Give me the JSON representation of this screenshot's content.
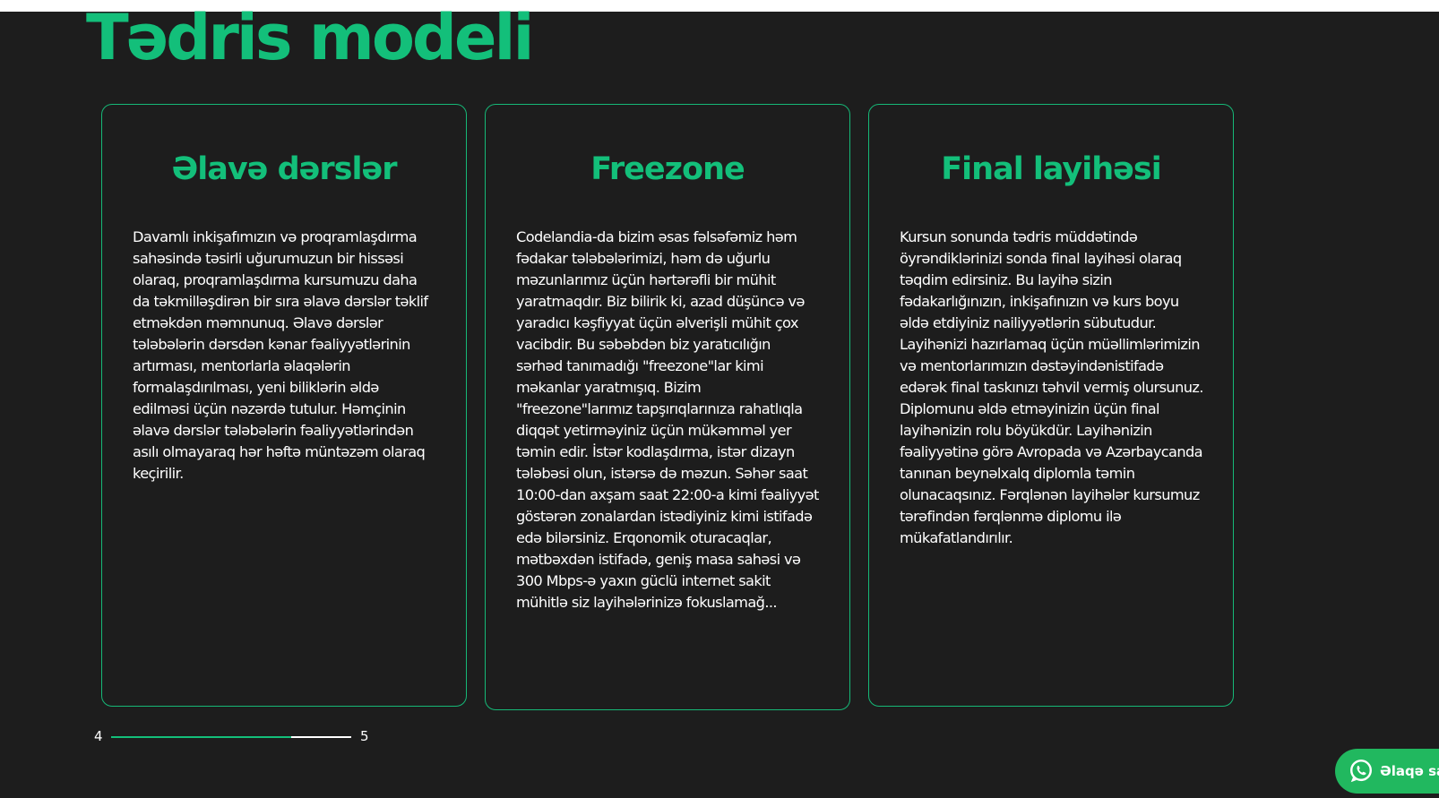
{
  "section": {
    "title": "Tədris modeli"
  },
  "cards": [
    {
      "title": "Əlavə dərslər",
      "text": "Davamlı inkişafımızın və proqramlaşdırma sahəsində təsirli uğurumuzun bir hissəsi olaraq, proqramlaşdırma kursumuzu daha da təkmilləşdirən bir sıra əlavə dərslər təklif etməkdən məmnunuq. Əlavə dərslər tələbələrin dərsdən kənar fəaliyyətlərinin artırması, mentorlarla əlaqələrin formalaşdırılması, yeni biliklərin əldə edilməsi üçün nəzərdə tutulur. Həmçinin əlavə dərslər tələbələrin fəaliyyətlərindən asılı olmayaraq hər həftə müntəzəm olaraq keçirilir."
    },
    {
      "title": "Freezone",
      "text": "Codelandia-da bizim əsas fəlsəfəmiz həm fədakar tələbələrimizi, həm də uğurlu məzunlarımız üçün hərtərəfli bir mühit yaratmaqdır. Biz bilirik ki, azad düşüncə və yaradıcı kəşfiyyat üçün əlverişli mühit çox vacibdir. Bu səbəbdən biz yaratıcılığın sərhəd tanımadığı \"freezone\"lar kimi məkanlar yaratmışıq. Bizim \"freezone\"larımız tapşırıqlarınıza rahatlıqla diqqət yetirməyiniz üçün mükəmməl yer təmin edir. İstər kodlaşdırma, istər dizayn tələbəsi olun, istərsə də məzun. Səhər saat 10:00-dan axşam saat 22:00-a kimi fəaliyyət göstərən zonalardan istədiyiniz kimi istifadə edə bilərsiniz. Erqonomik oturacaqlar, mətbəxdən istifadə, geniş masa sahəsi və 300 Mbps-ə yaxın güclü internet sakit mühitlə siz layihələrinizə fokuslamağ..."
    },
    {
      "title": "Final layihəsi",
      "text": "Kursun sonunda tədris müddətində öyrəndiklərinizi sonda final layihəsi olaraq təqdim edirsiniz. Bu layihə sizin fədakarlığınızın, inkişafınızın və kurs boyu əldə etdiyiniz nailiyyətlərin sübutudur. Layihənizi hazırlamaq üçün müəllimlərimizin və mentorlarımızın dəstəyindənistifadə edərək final taskınızı təhvil vermiş olursunuz. Diplomunu əldə etməyinizin üçün final layihənizin rolu böyükdür. Layihənizin fəaliyyətinə görə Avropada və Azərbaycanda tanınan beynəlxalq diplomla təmin olunacaqsınız. Fərqlənən layihələr kursumuz tərəfindən fərqlənmə diplomu ilə mükafatlandırılır."
    }
  ],
  "pager": {
    "current": "4",
    "total": "5",
    "progress_fraction": 0.75
  },
  "contact": {
    "label": "Əlaqə saxla",
    "icon": "whatsapp-icon"
  },
  "colors": {
    "accent": "#13bf7a",
    "background": "#1d1d1d",
    "text": "#ffffff",
    "whatsapp": "#21b85f"
  }
}
